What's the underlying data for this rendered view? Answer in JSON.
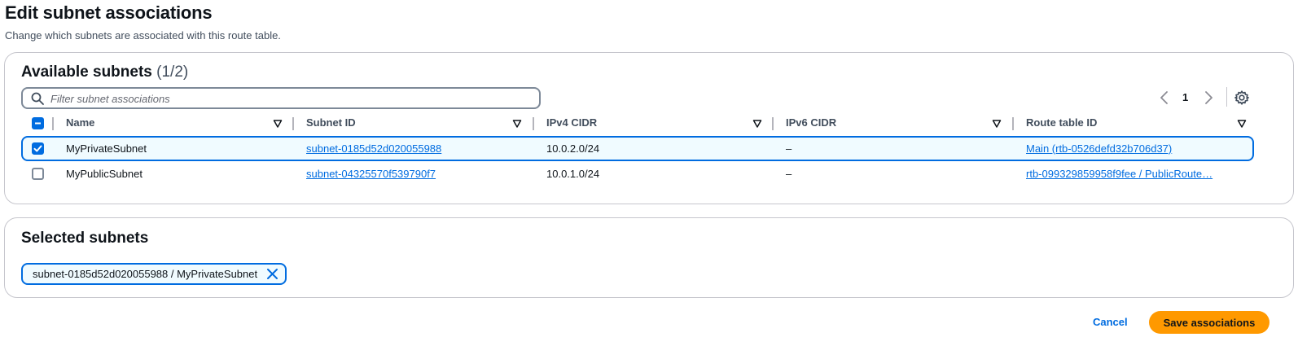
{
  "page": {
    "title": "Edit subnet associations",
    "description": "Change which subnets are associated with this route table."
  },
  "available": {
    "heading": "Available subnets",
    "count": "(1/2)",
    "filter_placeholder": "Filter subnet associations",
    "filter_value": "",
    "page_number": "1",
    "columns": [
      "Name",
      "Subnet ID",
      "IPv4 CIDR",
      "IPv6 CIDR",
      "Route table ID"
    ],
    "rows": [
      {
        "selected": true,
        "name": "MyPrivateSubnet",
        "subnet_id": "subnet-0185d52d020055988",
        "ipv4": "10.0.2.0/24",
        "ipv6": "–",
        "route_table": "Main (rtb-0526defd32b706d37)"
      },
      {
        "selected": false,
        "name": "MyPublicSubnet",
        "subnet_id": "subnet-04325570f539790f7",
        "ipv4": "10.0.1.0/24",
        "ipv6": "–",
        "route_table": "rtb-099329859958f9fee / PublicRoute…"
      }
    ]
  },
  "selected": {
    "heading": "Selected subnets",
    "tokens": [
      "subnet-0185d52d020055988 / MyPrivateSubnet"
    ]
  },
  "actions": {
    "cancel": "Cancel",
    "save": "Save associations"
  },
  "icons": {
    "search": "search-icon",
    "prev": "chevron-left-icon",
    "next": "chevron-right-icon",
    "settings": "gear-icon",
    "sort": "sort-down-icon",
    "dismiss": "close-icon"
  },
  "colors": {
    "accent": "#006ce0",
    "primary_button": "#ff9900",
    "selected_row_bg": "#f0fbff"
  }
}
